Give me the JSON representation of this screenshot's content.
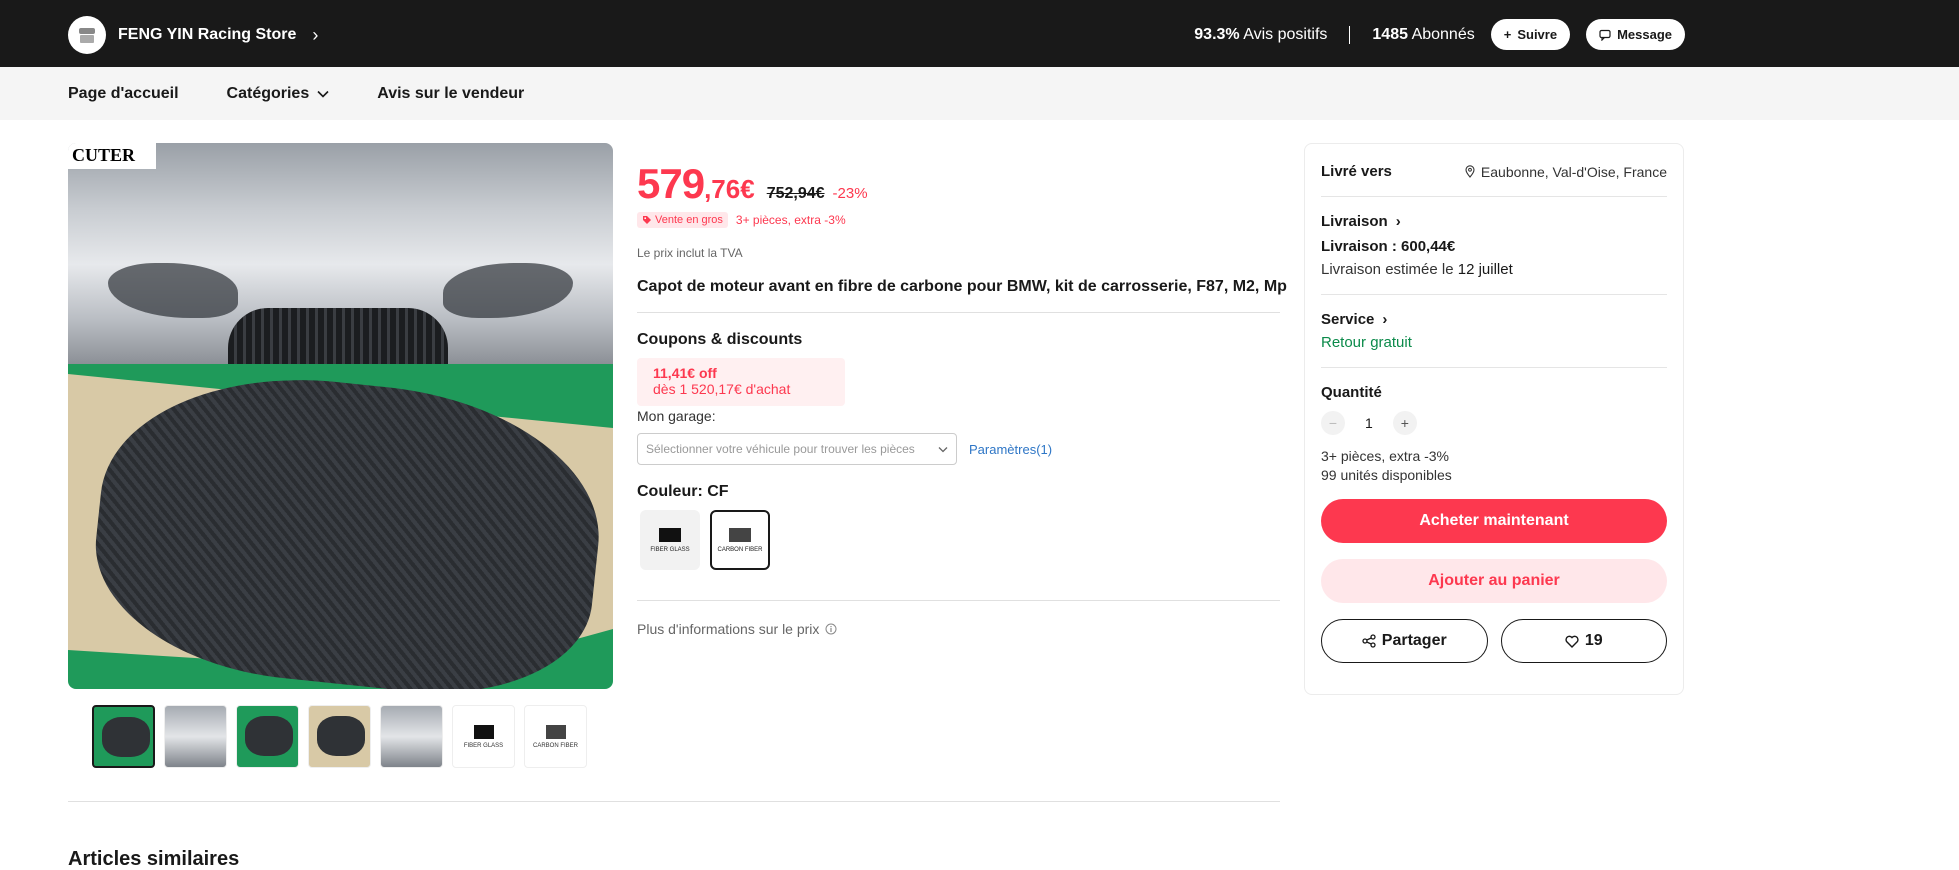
{
  "store": {
    "name": "FENG YIN Racing Store",
    "rating_value": "93.3%",
    "rating_label": "Avis positifs",
    "followers_value": "1485",
    "followers_label": "Abonnés",
    "follow_label": "Suivre",
    "message_label": "Message"
  },
  "nav": {
    "home": "Page d'accueil",
    "categories": "Catégories",
    "reviews": "Avis sur le vendeur"
  },
  "gallery": {
    "brand_logo": "CUTER",
    "thumbs": [
      {
        "kind": "hood"
      },
      {
        "kind": "car"
      },
      {
        "kind": "hood"
      },
      {
        "kind": "hood"
      },
      {
        "kind": "car"
      },
      {
        "kind": "swatch",
        "label": "FIBER GLASS"
      },
      {
        "kind": "swatch",
        "label": "CARBON FIBER"
      }
    ]
  },
  "product": {
    "price_int": "579",
    "price_dec": ",76€",
    "price_old": "752,94€",
    "discount": "-23%",
    "badge": "Vente en gros",
    "promo": "3+ pièces, extra -3%",
    "tva": "Le prix inclut la TVA",
    "title": "Capot de moteur avant en fibre de carbone pour BMW, kit de carrosserie, F87, M2, Mp",
    "coupons_title": "Coupons & discounts",
    "coupon_amount": "11,41€ off",
    "coupon_condition": "dès 1 520,17€ d'achat",
    "garage_label": "Mon garage:",
    "garage_placeholder": "Sélectionner votre véhicule pour trouver les pièces",
    "params_link": "Paramètres(1)",
    "color_title": "Couleur: CF",
    "colors": [
      {
        "label": "FIBER GLASS",
        "color": "#111111",
        "selected": false
      },
      {
        "label": "CARBON FIBER",
        "color": "#444444",
        "selected": true
      }
    ],
    "more_info": "Plus d'informations sur le prix"
  },
  "purchase": {
    "ship_to_label": "Livré vers",
    "ship_to_location": "Eaubonne, Val-d'Oise, France",
    "delivery_title": "Livraison",
    "delivery_cost": "Livraison : 600,44€",
    "delivery_estimate_prefix": "Livraison estimée le ",
    "delivery_estimate_date": "12 juillet",
    "service_title": "Service",
    "service_value": "Retour gratuit",
    "quantity_title": "Quantité",
    "quantity_value": "1",
    "quantity_promo": "3+ pièces, extra -3%",
    "stock": "99 unités disponibles",
    "buy_now": "Acheter maintenant",
    "add_to_cart": "Ajouter au panier",
    "share": "Partager",
    "wishlist_count": "19"
  },
  "similar_title": "Articles similaires",
  "colors": {
    "accent": "#fd384f",
    "accent_light": "#ffe7ea",
    "dark": "#191919",
    "green": "#0b8a4a",
    "link": "#2e76c6"
  }
}
